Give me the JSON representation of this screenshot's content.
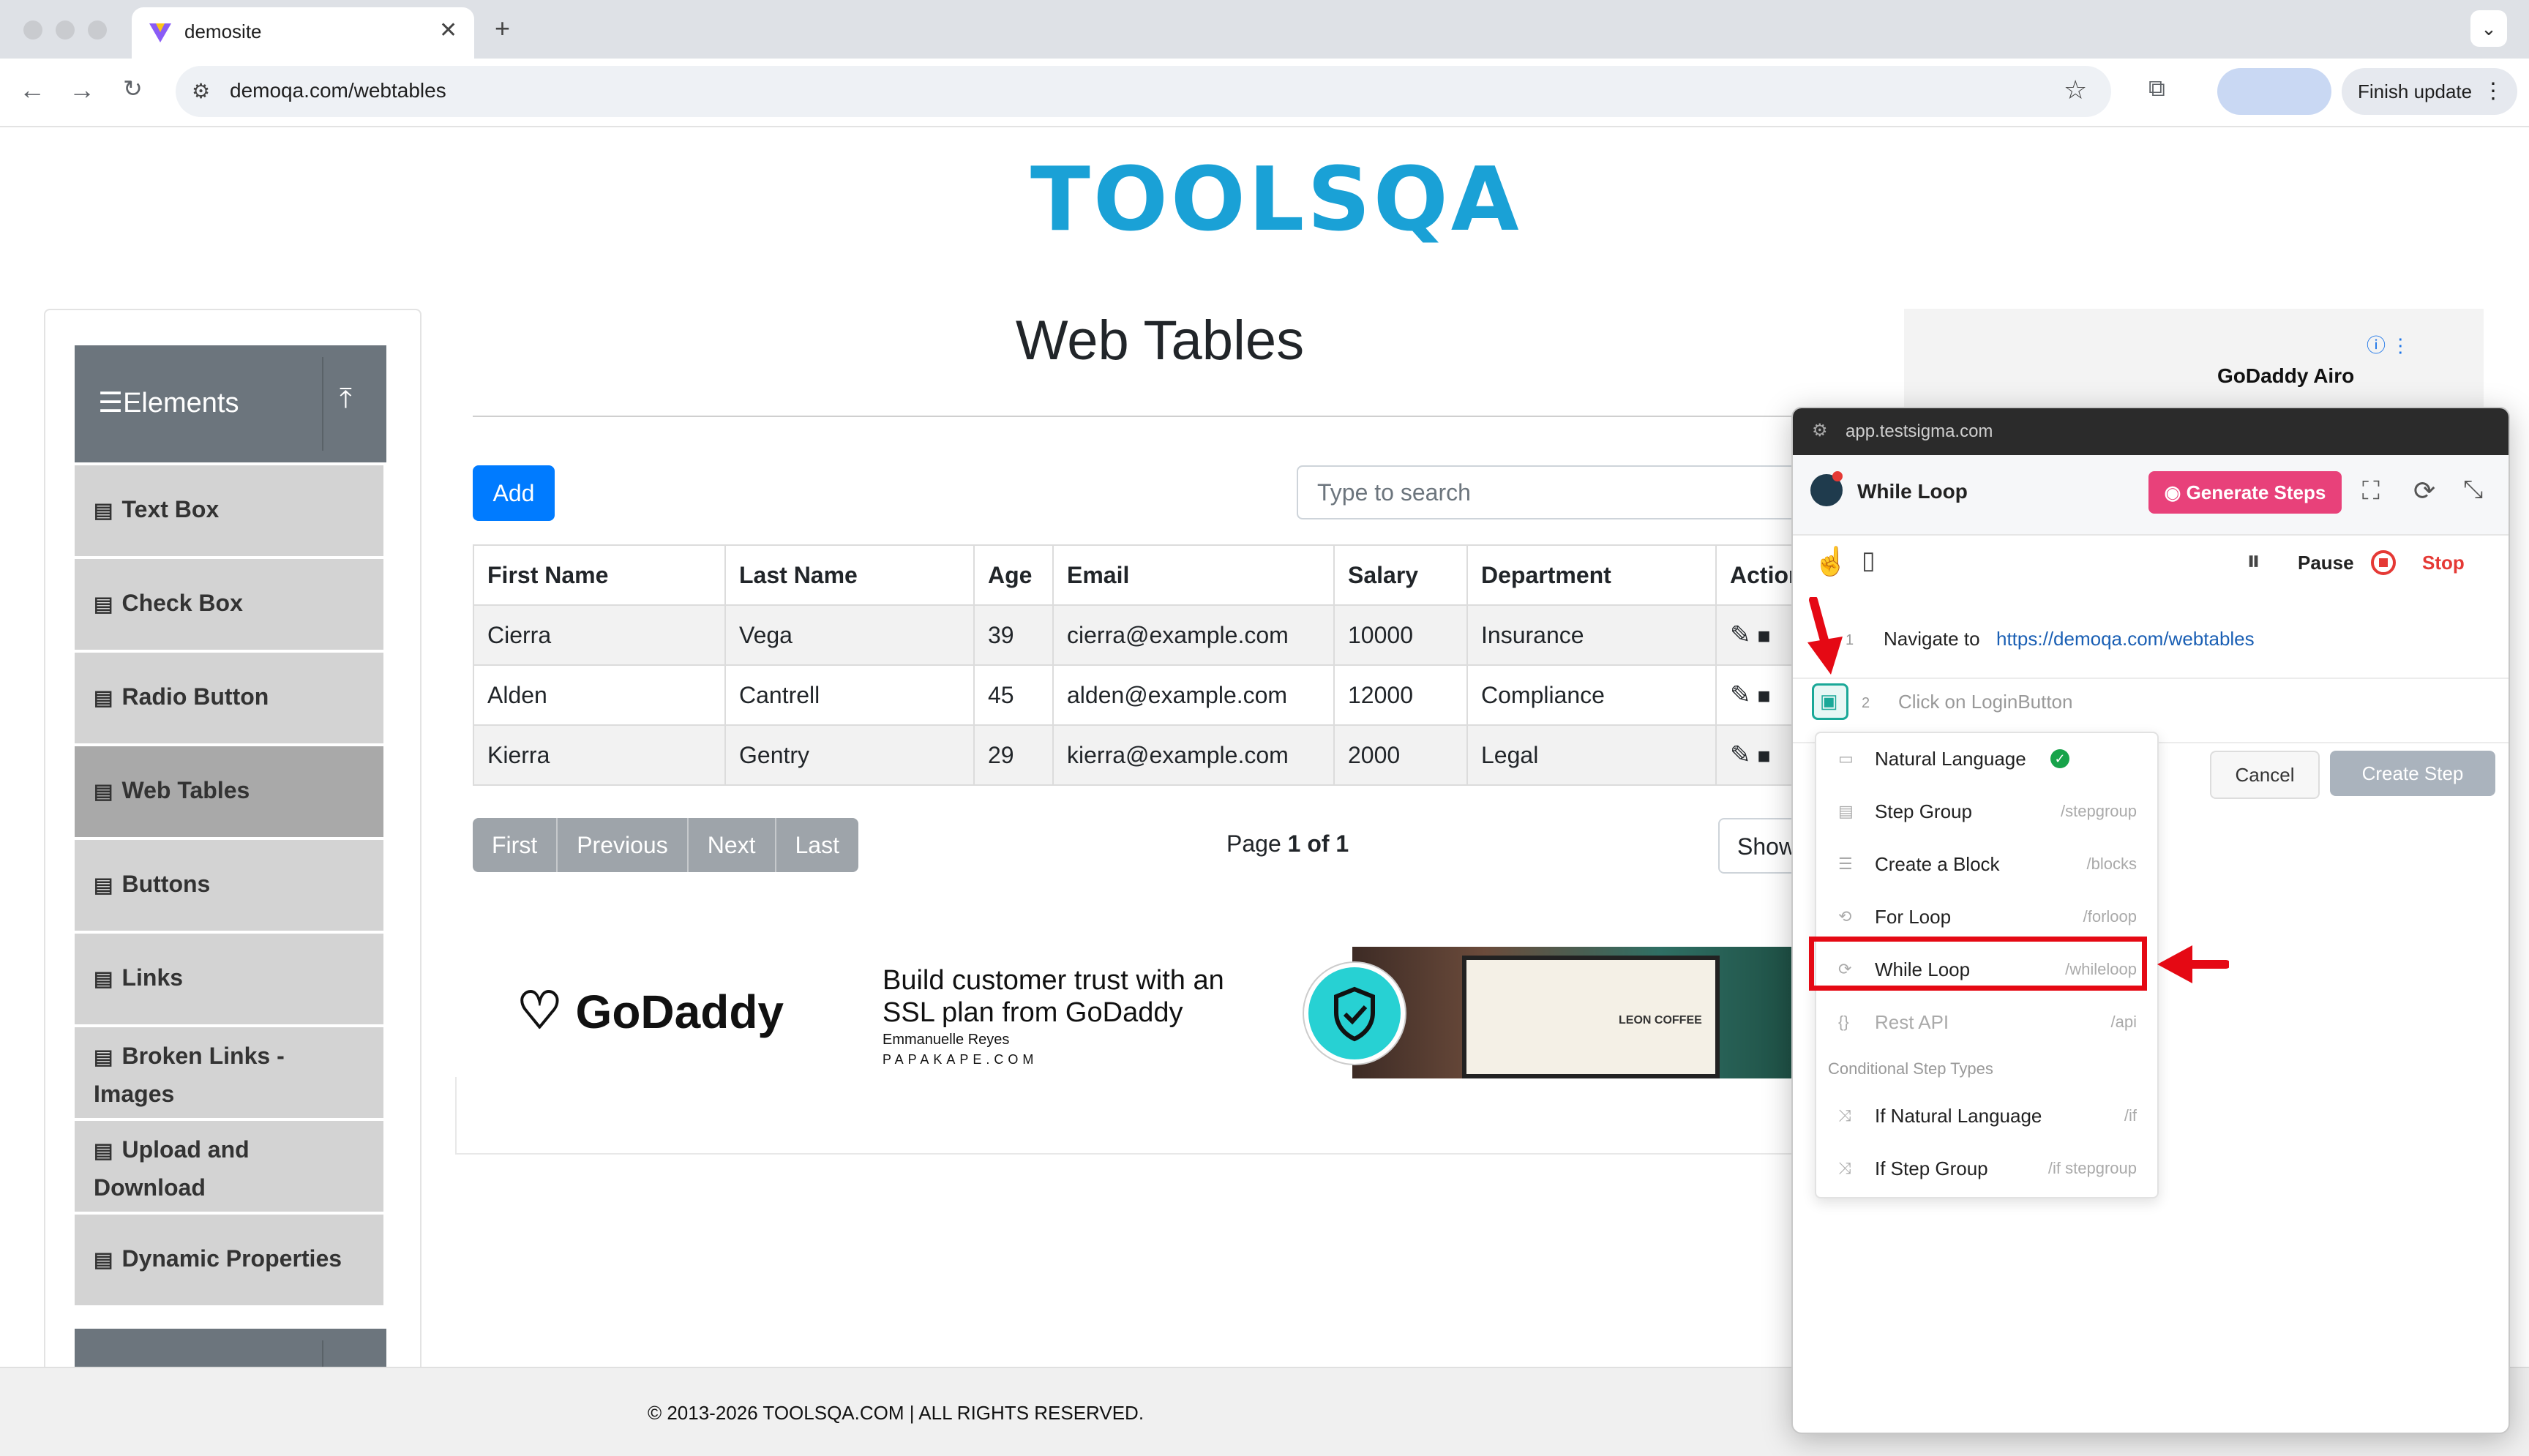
{
  "browser": {
    "tab_title": "demosite",
    "url": "demoqa.com/webtables",
    "finish_update": "Finish update"
  },
  "site": {
    "logo_text": "TOOLSQA",
    "page_title": "Web Tables",
    "footer": "© 2013-2026 TOOLSQA.COM | ALL RIGHTS RESERVED."
  },
  "sidebar": {
    "group": "Elements",
    "items": [
      {
        "label": "Text Box"
      },
      {
        "label": "Check Box"
      },
      {
        "label": "Radio Button"
      },
      {
        "label": "Web Tables"
      },
      {
        "label": "Buttons"
      },
      {
        "label": "Links"
      },
      {
        "label": "Broken Links - Images"
      },
      {
        "label": "Upload and Download"
      },
      {
        "label": "Dynamic Properties"
      }
    ]
  },
  "table": {
    "add_label": "Add",
    "search_placeholder": "Type to search",
    "headers": [
      "First Name",
      "Last Name",
      "Age",
      "Email",
      "Salary",
      "Department",
      "Action"
    ],
    "rows": [
      [
        "Cierra",
        "Vega",
        "39",
        "cierra@example.com",
        "10000",
        "Insurance"
      ],
      [
        "Alden",
        "Cantrell",
        "45",
        "alden@example.com",
        "12000",
        "Compliance"
      ],
      [
        "Kierra",
        "Gentry",
        "29",
        "kierra@example.com",
        "2000",
        "Legal"
      ]
    ],
    "pager": {
      "first": "First",
      "previous": "Previous",
      "next": "Next",
      "last": "Last",
      "page_prefix": "Page ",
      "page_bold": "1 of 1",
      "show": "Show"
    }
  },
  "ad": {
    "brand": "GoDaddy",
    "headline": "Build customer trust with an SSL plan from GoDaddy",
    "person": "Emmanuelle Reyes",
    "domain": "PAPAKAPE.COM",
    "laptop_text": "LEON COFFEE",
    "side_brand": "GoDaddy Airo"
  },
  "panel": {
    "url": "app.testsigma.com",
    "title": "While Loop",
    "generate_steps": "Generate Steps",
    "pause": "Pause",
    "stop": "Stop",
    "steps": [
      {
        "num": "1",
        "text": "Navigate to",
        "url": "https://demoqa.com/webtables"
      },
      {
        "num": "2",
        "text": "Click on LoginButton"
      }
    ],
    "cancel": "Cancel",
    "create_step": "Create Step",
    "menu": [
      {
        "label": "Natural Language",
        "cmd": ""
      },
      {
        "label": "Step Group",
        "cmd": "/stepgroup"
      },
      {
        "label": "Create a Block",
        "cmd": "/blocks"
      },
      {
        "label": "For Loop",
        "cmd": "/forloop"
      },
      {
        "label": "While Loop",
        "cmd": "/whileloop"
      },
      {
        "label": "Rest API",
        "cmd": "/api"
      }
    ],
    "conditional_heading": "Conditional Step Types",
    "conditional_menu": [
      {
        "label": "If Natural Language",
        "cmd": "/if"
      },
      {
        "label": "If Step Group",
        "cmd": "/if stepgroup"
      }
    ]
  },
  "colors": {
    "annotation": "#e50914",
    "primary": "#007bff",
    "generate": "#e8417a",
    "brand_blue": "#1aa1d6"
  }
}
